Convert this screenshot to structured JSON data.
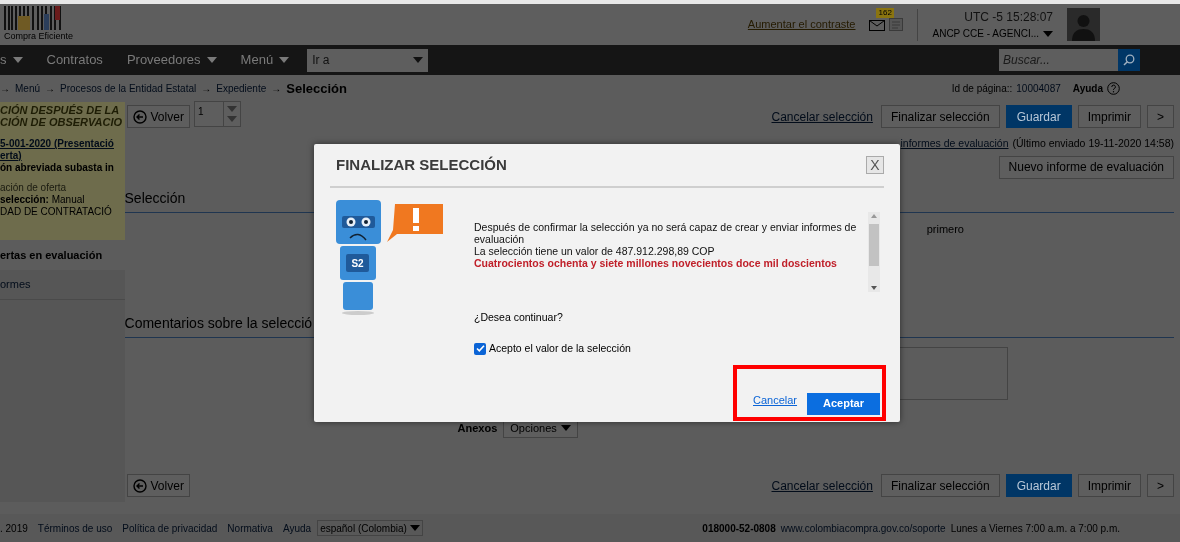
{
  "header": {
    "logo_caption": "Compra Eficiente",
    "contrast_link": "Aumentar el contraste",
    "mail_badge": "162",
    "clock": "UTC -5 15:28:07",
    "account": "ANCP CCE - AGENCI..."
  },
  "nav": {
    "items": [
      {
        "label": "s",
        "dropdown": true
      },
      {
        "label": "Contratos",
        "dropdown": false
      },
      {
        "label": "Proveedores",
        "dropdown": true
      },
      {
        "label": "Menú",
        "dropdown": true
      }
    ],
    "goto": "Ir a",
    "search": {
      "placeholder": "Buscar..."
    }
  },
  "breadcrumb": {
    "separator": "→",
    "links": [
      "Menú",
      "Procesos de la Entidad Estatal",
      "Expediente"
    ],
    "current": "Selección",
    "page_id_label": "Id de página::",
    "page_id": "10004087",
    "help": "Ayuda"
  },
  "sidebar": {
    "title_lines": [
      "CIÓN DESPUÉS DE LA",
      "CIÓN DE OBSERVACIO"
    ],
    "process_links": [
      "5-001-2020 (Presentació",
      "erta)"
    ],
    "details": [
      "ón abreviada subasta in",
      "ación de oferta",
      "**selección:** Manual",
      "DAD DE CONTRATACIÓ"
    ],
    "menu": [
      {
        "label": "ertas en evaluación",
        "selected": true
      },
      {
        "label": "ormes",
        "selected": false
      }
    ]
  },
  "toolbar": {
    "back": "Volver",
    "page_number": "1",
    "cancel_link": "Cancelar selección",
    "buttons": [
      {
        "label": "Finalizar selección",
        "primary": false
      },
      {
        "label": "Guardar",
        "primary": true
      },
      {
        "label": "Imprimir",
        "primary": false
      },
      {
        "label": ">",
        "primary": false
      }
    ]
  },
  "reports": {
    "link": "informes de evaluación",
    "last_sent": "(Último enviado 19-11-2020 14:58)",
    "new_button": "Nuevo informe de evaluación"
  },
  "sections": {
    "selection_title": "Selección",
    "selection_text": "primero",
    "comments_title": "Comentarios sobre la selecció",
    "annexes_label": "Anexos",
    "options_button": "Opciones"
  },
  "bottom_toolbar": {
    "back": "Volver",
    "cancel_link": "Cancelar selección",
    "buttons": [
      {
        "label": "Finalizar selección",
        "primary": false
      },
      {
        "label": "Guardar",
        "primary": true
      },
      {
        "label": "Imprimir",
        "primary": false
      },
      {
        "label": ">",
        "primary": false
      }
    ]
  },
  "footer": {
    "year": ". 2019",
    "links": [
      "Términos de uso",
      "Política de privacidad",
      "Normativa",
      "Ayuda"
    ],
    "language": "español (Colombia)",
    "phone": "018000-52-0808",
    "support_link": "www.colombiacompra.gov.co/soporte",
    "hours": "Lunes a Viernes 7:00 a.m. a 7:00 p.m."
  },
  "dialog": {
    "title": "FINALIZAR SELECCIÓN",
    "close": "X",
    "mascot_label": "S2",
    "messages": [
      {
        "text": "Después de confirmar la selección ya no será capaz de crear y enviar informes de evaluación",
        "warning": false
      },
      {
        "text": "La selección tiene un valor de 487.912.298,89 COP",
        "warning": false
      },
      {
        "text": "Cuatrocientos ochenta y siete millones novecientos doce mil doscientos",
        "warning": true
      }
    ],
    "question": "¿Desea continuar?",
    "accept_checkbox": {
      "label": "Acepto el valor de la selección",
      "checked": true
    },
    "cancel": "Cancelar",
    "accept": "Aceptar",
    "highlight_buttons": true
  }
}
